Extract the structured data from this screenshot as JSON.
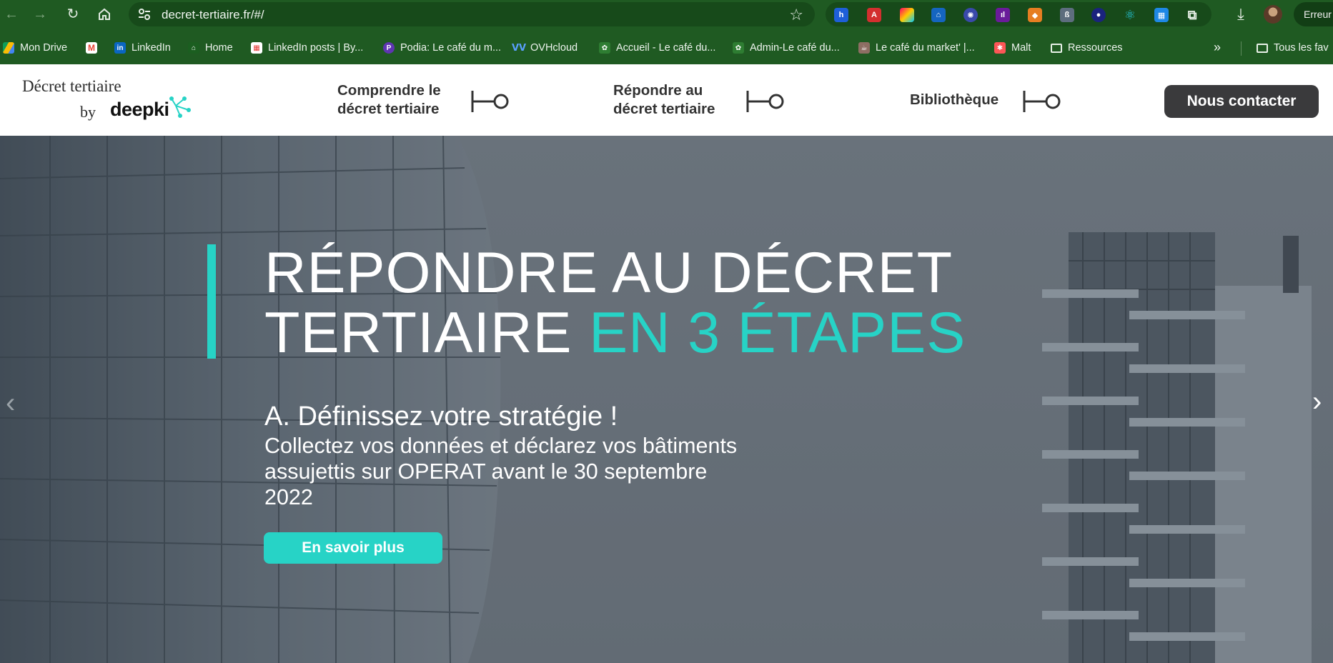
{
  "browser": {
    "url": "decret-tertiaire.fr/#/",
    "error_label": "Erreur",
    "bookmarks": [
      {
        "label": "Mon Drive",
        "color": "#1a73e8"
      },
      {
        "label": "",
        "color": "#ea4335"
      },
      {
        "label": "LinkedIn",
        "color": "#0a66c2"
      },
      {
        "label": "Home",
        "color": "#2e7d32"
      },
      {
        "label": "LinkedIn posts | By...",
        "color": "#e53935"
      },
      {
        "label": "Podia: Le café du m...",
        "color": "#5e35b1"
      },
      {
        "label": "OVHcloud",
        "color": "#123f6d"
      },
      {
        "label": "Accueil - Le café du...",
        "color": "#2e7d32"
      },
      {
        "label": "Admin-Le café du...",
        "color": "#2e7d32"
      },
      {
        "label": "Le café du market' |...",
        "color": "#8d6e63"
      },
      {
        "label": "Malt",
        "color": "#fc5656"
      },
      {
        "label": "Ressources",
        "color": "#e8f0e8"
      },
      {
        "label": "Tous les fav",
        "color": "#e8f0e8"
      }
    ]
  },
  "site": {
    "logo": {
      "line1": "Décret tertiaire",
      "by": "by",
      "brand": "deepki"
    },
    "nav": [
      {
        "line1": "Comprendre le",
        "line2": "décret tertiaire"
      },
      {
        "line1": "Répondre au",
        "line2": "décret tertiaire"
      },
      {
        "line1": "Bibliothèque",
        "line2": ""
      }
    ],
    "contact_label": "Nous contacter",
    "accent_color": "#27d3c6"
  },
  "hero": {
    "title_line1": "RÉPONDRE AU DÉCRET",
    "title_line2_plain": "TERTIAIRE ",
    "title_line2_accent": "EN 3 ÉTAPES",
    "subtitle": "A. Définissez votre stratégie !",
    "description": "Collectez vos données et déclarez vos bâtiments assujettis sur OPERAT avant le 30 septembre 2022",
    "cta_label": "En savoir plus",
    "arrow_left": "‹",
    "arrow_right": "›"
  }
}
